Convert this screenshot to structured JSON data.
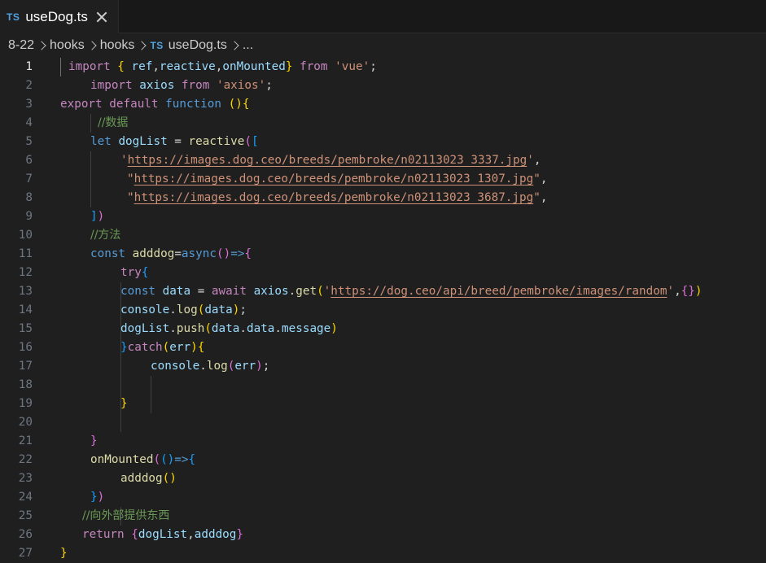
{
  "tab": {
    "badge": "TS",
    "label": "useDog.ts"
  },
  "breadcrumb": {
    "items": [
      "8-22",
      "hooks",
      "hooks"
    ],
    "file_badge": "TS",
    "file": "useDog.ts",
    "more": "..."
  },
  "editor": {
    "active_line": 1,
    "lines": [
      {
        "n": "1",
        "indent": 84,
        "tokens": [
          [
            "kwc",
            "import"
          ],
          [
            "pun",
            " "
          ],
          [
            "b1",
            "{"
          ],
          [
            "pun",
            " "
          ],
          [
            "var",
            "ref"
          ],
          [
            "pun",
            ","
          ],
          [
            "var",
            "reactive"
          ],
          [
            "pun",
            ","
          ],
          [
            "var",
            "onMounted"
          ],
          [
            "b1",
            "}"
          ],
          [
            "pun",
            " "
          ],
          [
            "kwc",
            "from"
          ],
          [
            "pun",
            " "
          ],
          [
            "str",
            "'vue'"
          ],
          [
            "pun",
            ";"
          ]
        ]
      },
      {
        "n": "2",
        "indent": 111,
        "tokens": [
          [
            "kwc",
            "import"
          ],
          [
            "pun",
            " "
          ],
          [
            "var",
            "axios"
          ],
          [
            "pun",
            " "
          ],
          [
            "kwc",
            "from"
          ],
          [
            "pun",
            " "
          ],
          [
            "str",
            "'axios'"
          ],
          [
            "pun",
            ";"
          ]
        ]
      },
      {
        "n": "3",
        "indent": 74,
        "tokens": [
          [
            "kwc",
            "export"
          ],
          [
            "pun",
            " "
          ],
          [
            "kwc",
            "default"
          ],
          [
            "pun",
            " "
          ],
          [
            "kw",
            "function"
          ],
          [
            "pun",
            " "
          ],
          [
            "b1",
            "()"
          ],
          [
            "b1",
            "{"
          ]
        ]
      },
      {
        "n": "4",
        "indent": 120,
        "tokens": [
          [
            "cmt",
            "//数据"
          ]
        ]
      },
      {
        "n": "5",
        "indent": 111,
        "tokens": [
          [
            "kw",
            "let"
          ],
          [
            "pun",
            " "
          ],
          [
            "var",
            "dogList"
          ],
          [
            "pun",
            " = "
          ],
          [
            "fn",
            "reactive"
          ],
          [
            "b2",
            "("
          ],
          [
            "b3",
            "["
          ]
        ]
      },
      {
        "n": "6",
        "indent": 148,
        "tokens": [
          [
            "str",
            "'"
          ],
          [
            "url",
            "https://images.dog.ceo/breeds/pembroke/n02113023_3337.jpg"
          ],
          [
            "str",
            "'"
          ],
          [
            "pun",
            ","
          ]
        ]
      },
      {
        "n": "7",
        "indent": 156,
        "tokens": [
          [
            "str",
            "\""
          ],
          [
            "url",
            "https://images.dog.ceo/breeds/pembroke/n02113023_1307.jpg"
          ],
          [
            "str",
            "\""
          ],
          [
            "pun",
            ","
          ]
        ]
      },
      {
        "n": "8",
        "indent": 156,
        "tokens": [
          [
            "str",
            "\""
          ],
          [
            "url",
            "https://images.dog.ceo/breeds/pembroke/n02113023_3687.jpg"
          ],
          [
            "str",
            "\""
          ],
          [
            "pun",
            ","
          ]
        ]
      },
      {
        "n": "9",
        "indent": 111,
        "tokens": [
          [
            "b3",
            "]"
          ],
          [
            "b2",
            ")"
          ]
        ]
      },
      {
        "n": "10",
        "indent": 111,
        "tokens": [
          [
            "cmt",
            "//方法"
          ]
        ]
      },
      {
        "n": "11",
        "indent": 111,
        "tokens": [
          [
            "kw",
            "const"
          ],
          [
            "pun",
            " "
          ],
          [
            "fn",
            "adddog"
          ],
          [
            "pun",
            "="
          ],
          [
            "kw",
            "async"
          ],
          [
            "b2",
            "()"
          ],
          [
            "kw",
            "=>"
          ],
          [
            "b2",
            "{"
          ]
        ]
      },
      {
        "n": "12",
        "indent": 148,
        "tokens": [
          [
            "kwc",
            "try"
          ],
          [
            "b3",
            "{"
          ]
        ]
      },
      {
        "n": "13",
        "indent": 148,
        "tokens": [
          [
            "kw",
            "const"
          ],
          [
            "pun",
            " "
          ],
          [
            "var",
            "data"
          ],
          [
            "pun",
            " = "
          ],
          [
            "kwc",
            "await"
          ],
          [
            "pun",
            " "
          ],
          [
            "var",
            "axios"
          ],
          [
            "pun",
            "."
          ],
          [
            "fn",
            "get"
          ],
          [
            "b1",
            "("
          ],
          [
            "str",
            "'"
          ],
          [
            "url",
            "https://dog.ceo/api/breed/pembroke/images/random"
          ],
          [
            "str",
            "'"
          ],
          [
            "pun",
            ","
          ],
          [
            "b2",
            "{}"
          ],
          [
            "b1",
            ")"
          ]
        ]
      },
      {
        "n": "14",
        "indent": 148,
        "tokens": [
          [
            "var",
            "console"
          ],
          [
            "pun",
            "."
          ],
          [
            "fn",
            "log"
          ],
          [
            "b1",
            "("
          ],
          [
            "var",
            "data"
          ],
          [
            "b1",
            ")"
          ],
          [
            "pun",
            ";"
          ]
        ]
      },
      {
        "n": "15",
        "indent": 148,
        "tokens": [
          [
            "var",
            "dogList"
          ],
          [
            "pun",
            "."
          ],
          [
            "fn",
            "push"
          ],
          [
            "b1",
            "("
          ],
          [
            "var",
            "data"
          ],
          [
            "pun",
            "."
          ],
          [
            "var",
            "data"
          ],
          [
            "pun",
            "."
          ],
          [
            "var",
            "message"
          ],
          [
            "b1",
            ")"
          ]
        ]
      },
      {
        "n": "16",
        "indent": 148,
        "tokens": [
          [
            "b3",
            "}"
          ],
          [
            "kwc",
            "catch"
          ],
          [
            "b1",
            "("
          ],
          [
            "var",
            "err"
          ],
          [
            "b1",
            ")"
          ],
          [
            "b1",
            "{"
          ]
        ]
      },
      {
        "n": "17",
        "indent": 185,
        "tokens": [
          [
            "var",
            "console"
          ],
          [
            "pun",
            "."
          ],
          [
            "fn",
            "log"
          ],
          [
            "b2",
            "("
          ],
          [
            "var",
            "err"
          ],
          [
            "b2",
            ")"
          ],
          [
            "pun",
            ";"
          ]
        ]
      },
      {
        "n": "18",
        "indent": 185,
        "tokens": []
      },
      {
        "n": "19",
        "indent": 148,
        "tokens": [
          [
            "b1",
            "}"
          ]
        ]
      },
      {
        "n": "20",
        "indent": 148,
        "tokens": []
      },
      {
        "n": "21",
        "indent": 111,
        "tokens": [
          [
            "b2",
            "}"
          ]
        ]
      },
      {
        "n": "22",
        "indent": 111,
        "tokens": [
          [
            "fn",
            "onMounted"
          ],
          [
            "b2",
            "("
          ],
          [
            "b3",
            "()"
          ],
          [
            "kw",
            "=>"
          ],
          [
            "b3",
            "{"
          ]
        ]
      },
      {
        "n": "23",
        "indent": 148,
        "tokens": [
          [
            "fn",
            "adddog"
          ],
          [
            "b1",
            "()"
          ]
        ]
      },
      {
        "n": "24",
        "indent": 111,
        "tokens": [
          [
            "b3",
            "}"
          ],
          [
            "b2",
            ")"
          ]
        ]
      },
      {
        "n": "25",
        "indent": 101,
        "tokens": [
          [
            "cmt",
            "//向外部提供东西"
          ]
        ]
      },
      {
        "n": "26",
        "indent": 101,
        "tokens": [
          [
            "kwc",
            "return"
          ],
          [
            "pun",
            " "
          ],
          [
            "b2",
            "{"
          ],
          [
            "var",
            "dogList"
          ],
          [
            "pun",
            ","
          ],
          [
            "var",
            "adddog"
          ],
          [
            "b2",
            "}"
          ]
        ]
      },
      {
        "n": "27",
        "indent": 74,
        "tokens": [
          [
            "b1",
            "}"
          ]
        ]
      }
    ]
  },
  "colors": {
    "background": "#1f1f1f",
    "tabbar": "#181818",
    "ts_badge": "#4fa3e0",
    "keyword": "#569cd6",
    "control_keyword": "#c586c0",
    "variable": "#9cdcfe",
    "function": "#dcdcaa",
    "string": "#ce9178",
    "comment": "#6a9955"
  }
}
